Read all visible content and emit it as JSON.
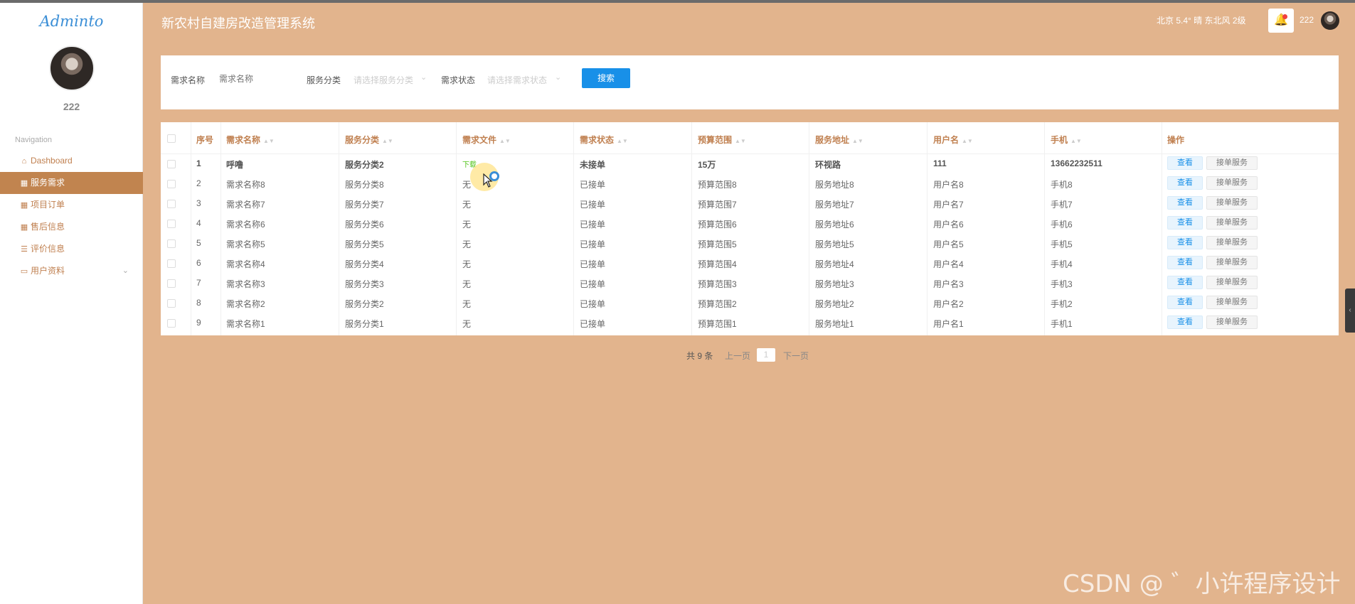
{
  "sidebar": {
    "logo": "Adminto",
    "username": "222",
    "nav_heading": "Navigation",
    "items": [
      {
        "label": "Dashboard",
        "icon": "home-icon",
        "glyph": "⌂"
      },
      {
        "label": "服务需求",
        "icon": "grid-icon",
        "glyph": "▦"
      },
      {
        "label": "项目订单",
        "icon": "grid-icon",
        "glyph": "▦"
      },
      {
        "label": "售后信息",
        "icon": "grid-icon",
        "glyph": "▦"
      },
      {
        "label": "评价信息",
        "icon": "list-icon",
        "glyph": "☰"
      },
      {
        "label": "用户资料",
        "icon": "calendar-icon",
        "glyph": "▭"
      }
    ],
    "active_index": 1
  },
  "header": {
    "title": "新农村自建房改造管理系统",
    "weather": "北京  5.4°  晴  东北风  2级",
    "username": "222"
  },
  "search": {
    "name_label": "需求名称",
    "name_placeholder": "需求名称",
    "category_label": "服务分类",
    "category_placeholder": "请选择服务分类",
    "status_label": "需求状态",
    "status_placeholder": "请选择需求状态",
    "button_label": "搜索"
  },
  "table": {
    "columns": [
      "序号",
      "需求名称",
      "服务分类",
      "需求文件",
      "需求状态",
      "预算范围",
      "服务地址",
      "用户名",
      "手机",
      "操作"
    ],
    "rows": [
      [
        "1",
        "呼噜",
        "服务分类2",
        "下载",
        "未接单",
        "15万",
        "环视路",
        "111",
        "13662232511"
      ],
      [
        "2",
        "需求名称8",
        "服务分类8",
        "无",
        "已接单",
        "预算范围8",
        "服务地址8",
        "用户名8",
        "手机8"
      ],
      [
        "3",
        "需求名称7",
        "服务分类7",
        "无",
        "已接单",
        "预算范围7",
        "服务地址7",
        "用户名7",
        "手机7"
      ],
      [
        "4",
        "需求名称6",
        "服务分类6",
        "无",
        "已接单",
        "预算范围6",
        "服务地址6",
        "用户名6",
        "手机6"
      ],
      [
        "5",
        "需求名称5",
        "服务分类5",
        "无",
        "已接单",
        "预算范围5",
        "服务地址5",
        "用户名5",
        "手机5"
      ],
      [
        "6",
        "需求名称4",
        "服务分类4",
        "无",
        "已接单",
        "预算范围4",
        "服务地址4",
        "用户名4",
        "手机4"
      ],
      [
        "7",
        "需求名称3",
        "服务分类3",
        "无",
        "已接单",
        "预算范围3",
        "服务地址3",
        "用户名3",
        "手机3"
      ],
      [
        "8",
        "需求名称2",
        "服务分类2",
        "无",
        "已接单",
        "预算范围2",
        "服务地址2",
        "用户名2",
        "手机2"
      ],
      [
        "9",
        "需求名称1",
        "服务分类1",
        "无",
        "已接单",
        "预算范围1",
        "服务地址1",
        "用户名1",
        "手机1"
      ]
    ],
    "view_label": "查看",
    "take_label": "接单服务"
  },
  "pagination": {
    "total": "共 9 条",
    "prev": "上一页",
    "current": "1",
    "next": "下一页"
  },
  "watermark": "CSDN @ ゛小许程序设计",
  "colors": {
    "background": "#e2b48d",
    "accent": "#c1844f",
    "primary_button": "#1890e8",
    "download_link": "#52c41a"
  }
}
